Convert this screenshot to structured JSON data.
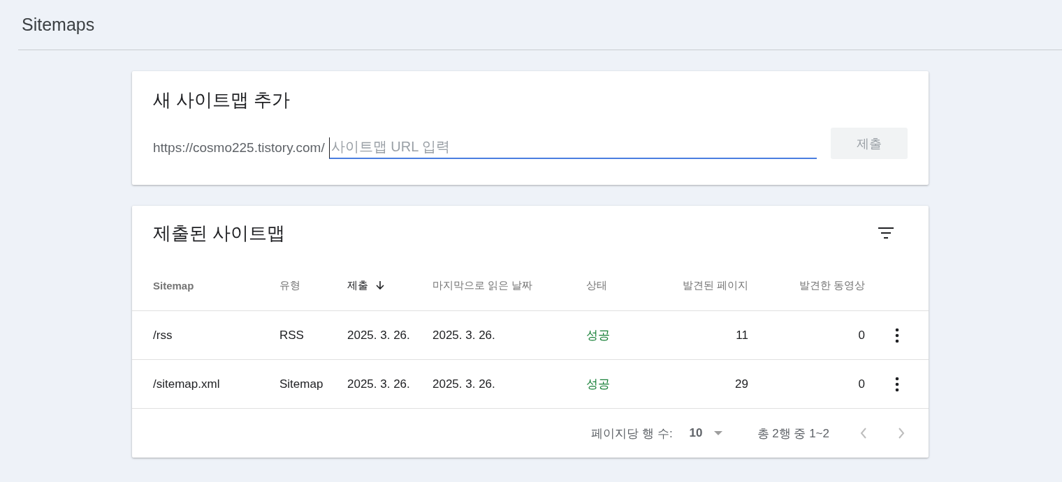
{
  "page_title": "Sitemaps",
  "add_card": {
    "title": "새 사이트맵 추가",
    "url_prefix": "https://cosmo225.tistory.com/",
    "input": {
      "placeholder": "사이트맵 URL 입력",
      "focused": true
    },
    "submit": {
      "label": "제출",
      "disabled": true
    }
  },
  "submitted_card": {
    "title": "제출된 사이트맵",
    "table": {
      "columns": [
        {
          "label": "Sitemap",
          "sorted": false
        },
        {
          "label": "유형",
          "sorted": false
        },
        {
          "label": "제출",
          "sorted": true
        },
        {
          "label": "마지막으로 읽은 날짜",
          "sorted": false
        },
        {
          "label": "상태",
          "sorted": false
        },
        {
          "label": "발견된 페이지",
          "sorted": false
        },
        {
          "label": "발견한 동영상",
          "sorted": false
        }
      ],
      "rows": [
        {
          "cells": [
            "/rss",
            "RSS",
            "2025. 3. 26.",
            "2025. 3. 26.",
            "성공",
            "11",
            "0"
          ]
        },
        {
          "cells": [
            "/sitemap.xml",
            "Sitemap",
            "2025. 3. 26.",
            "2025. 3. 26.",
            "성공",
            "29",
            "0"
          ]
        }
      ]
    },
    "pagination": {
      "rows_per_page_label": "페이지당 행 수:",
      "rows_per_page": "10",
      "range": "총 2행 중 1~2",
      "prev_disabled": true,
      "next_disabled": true
    }
  }
}
